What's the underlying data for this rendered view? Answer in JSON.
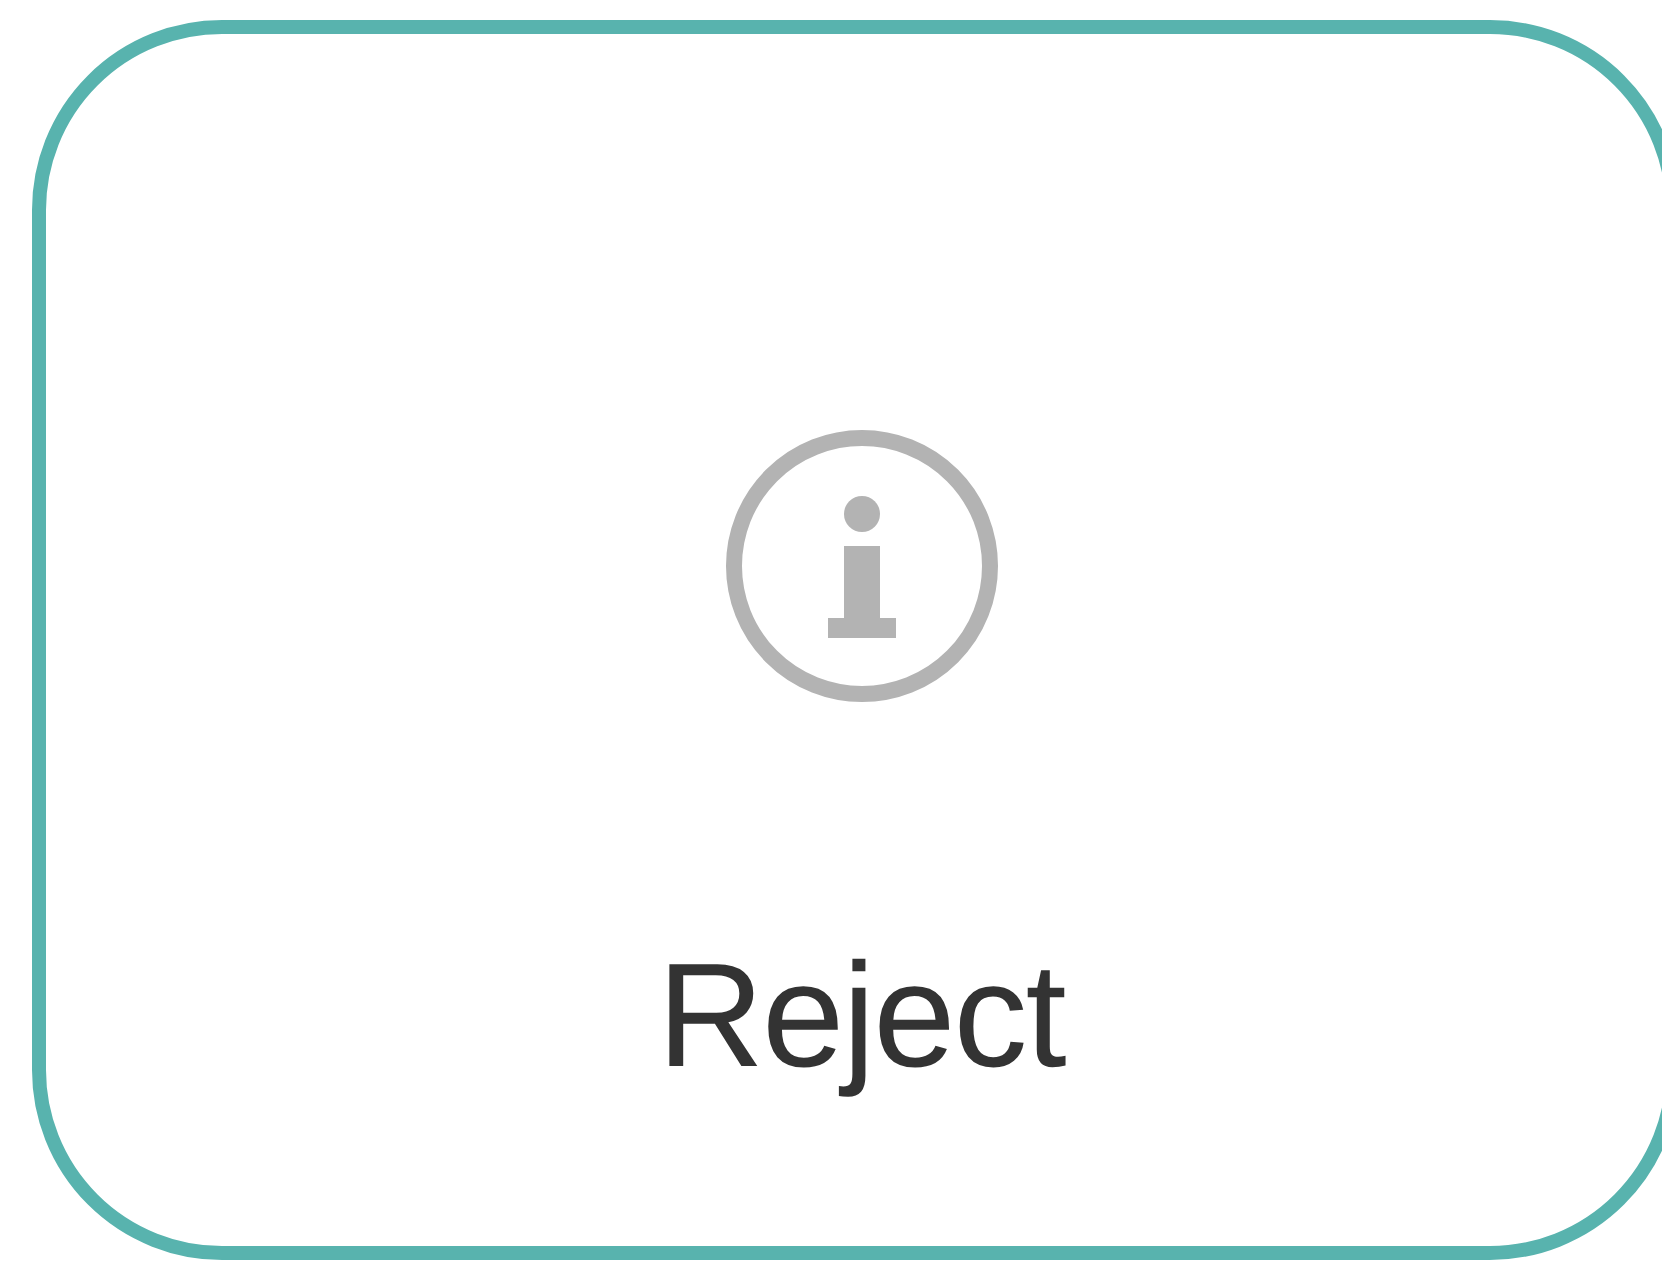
{
  "button": {
    "label": "Reject"
  }
}
